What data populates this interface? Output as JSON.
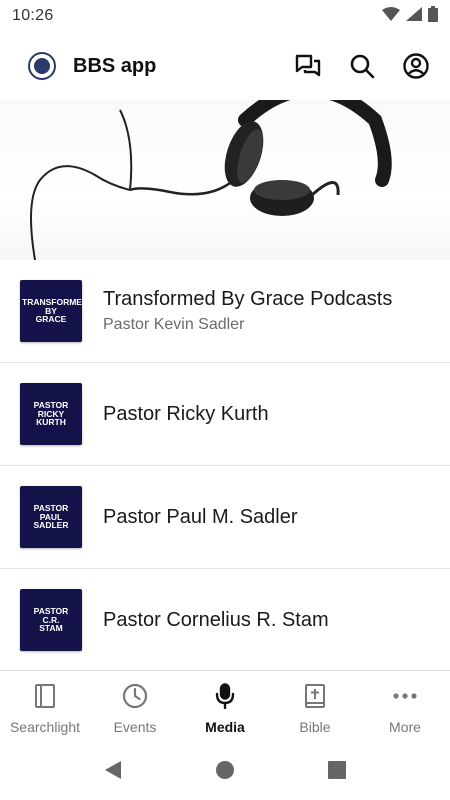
{
  "status_bar": {
    "time": "10:26",
    "icons": [
      "wifi-icon",
      "signal-icon",
      "battery-icon"
    ]
  },
  "app_bar": {
    "title": "BBS app",
    "actions": [
      "chat-icon",
      "search-icon",
      "account-icon"
    ]
  },
  "media_list": {
    "items": [
      {
        "thumb_text": "TRANSFORMED\nBY\nGRACE",
        "title": "Transformed By Grace Podcasts",
        "subtitle": "Pastor Kevin Sadler"
      },
      {
        "thumb_text": "PASTOR\nRICKY\nKURTH",
        "title": "Pastor Ricky Kurth",
        "subtitle": ""
      },
      {
        "thumb_text": "PASTOR\nPAUL\nSADLER",
        "title": "Pastor Paul M. Sadler",
        "subtitle": ""
      },
      {
        "thumb_text": "PASTOR\nC.R.\nSTAM",
        "title": "Pastor Cornelius R. Stam",
        "subtitle": ""
      }
    ]
  },
  "bottom_nav": {
    "items": [
      {
        "label": "Searchlight",
        "icon": "book-icon",
        "active": false
      },
      {
        "label": "Events",
        "icon": "clock-icon",
        "active": false
      },
      {
        "label": "Media",
        "icon": "microphone-icon",
        "active": true
      },
      {
        "label": "Bible",
        "icon": "bible-icon",
        "active": false
      },
      {
        "label": "More",
        "icon": "more-icon",
        "active": false
      }
    ]
  },
  "colors": {
    "thumb_background": "#13134a",
    "active_nav": "#111111",
    "inactive_nav": "#777777"
  }
}
